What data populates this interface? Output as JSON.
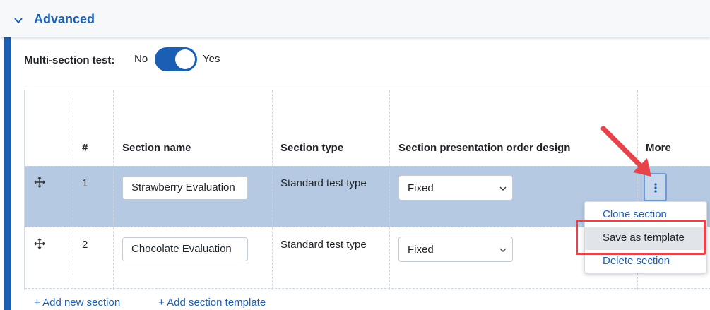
{
  "section": {
    "title": "Advanced"
  },
  "multi_section": {
    "label": "Multi-section test:",
    "off_label": "No",
    "on_label": "Yes",
    "enabled": true
  },
  "table": {
    "headers": [
      "#",
      "Section name",
      "Section type",
      "Section presentation order design",
      "More"
    ],
    "rows": [
      {
        "num": "1",
        "name": "Strawberry Evaluation",
        "type": "Standard test type",
        "order": "Fixed"
      },
      {
        "num": "2",
        "name": "Chocolate Evaluation",
        "type": "Standard test type",
        "order": "Fixed"
      }
    ]
  },
  "more_menu": {
    "items": [
      "Clone section",
      "Save as template",
      "Delete section"
    ]
  },
  "actions": {
    "add_section": "+ Add new section",
    "add_template": "+ Add section template"
  },
  "colors": {
    "accent": "#1a5fb4",
    "row_selected": "#b5c9e2",
    "highlight_box": "#e8434b"
  },
  "icons": {
    "collapse": "chevron-down-icon",
    "drag": "move-icon",
    "more": "vertical-dots-icon",
    "dropdown": "chevron-down-icon"
  }
}
